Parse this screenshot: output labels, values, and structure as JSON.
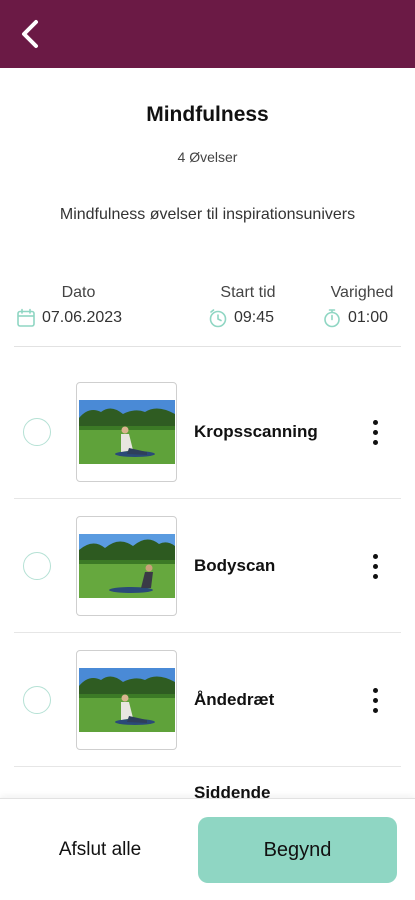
{
  "header": {
    "back_icon": "chevron-left-icon",
    "bar_color": "#6b1a45"
  },
  "program": {
    "title": "Mindfulness",
    "count": "4 Øvelser",
    "description": "Mindfulness øvelser til inspirationsunivers"
  },
  "info": {
    "date_label": "Dato",
    "date_value": "07.06.2023",
    "start_label": "Start tid",
    "start_value": "09:45",
    "duration_label": "Varighed",
    "duration_value": "01:00",
    "accent_color": "#8fd6c3"
  },
  "exercises": [
    {
      "name": "Kropsscanning",
      "icon": "more-vert-icon"
    },
    {
      "name": "Bodyscan",
      "icon": "more-vert-icon"
    },
    {
      "name": "Åndedræt",
      "icon": "more-vert-icon"
    },
    {
      "name": "Siddende"
    }
  ],
  "footer": {
    "end_all_label": "Afslut alle",
    "start_label": "Begynd",
    "start_color": "#8fd6c3"
  }
}
